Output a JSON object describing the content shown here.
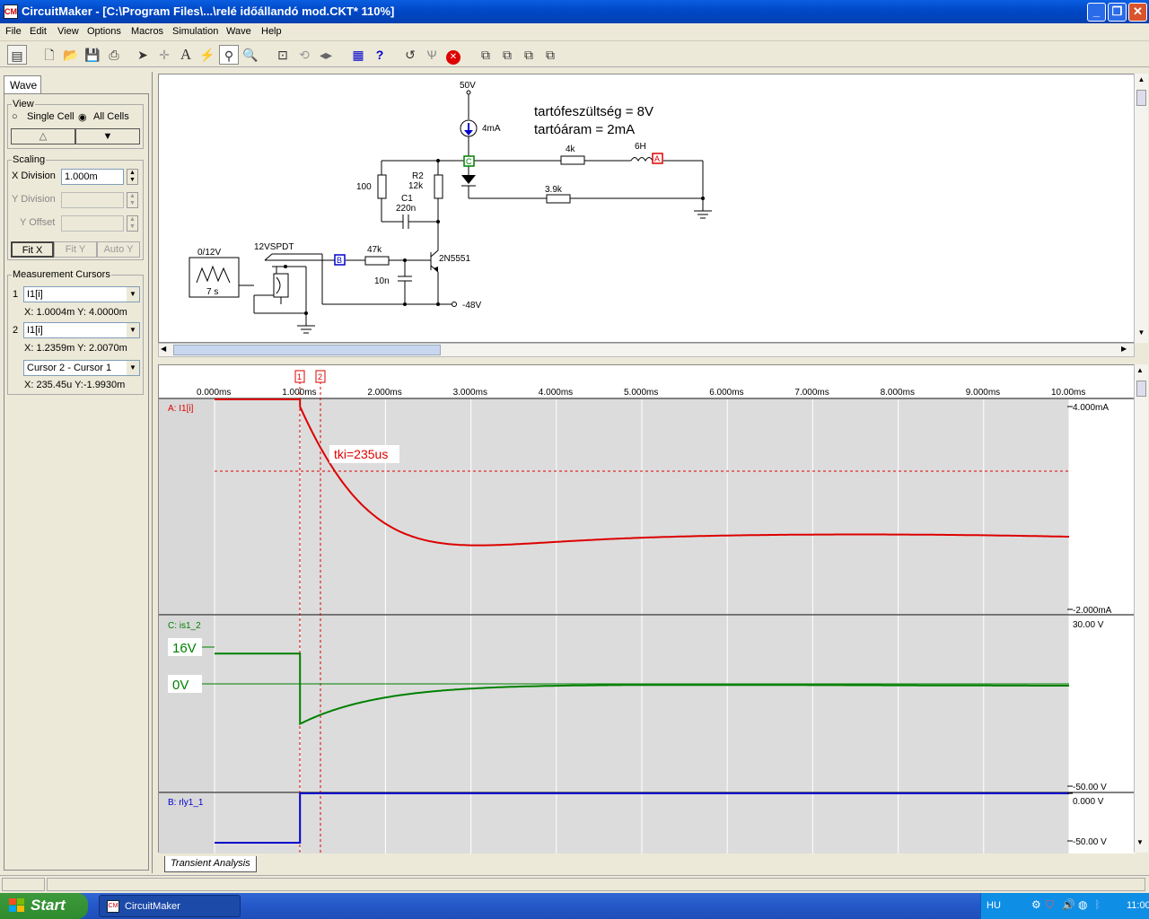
{
  "window": {
    "title": "CircuitMaker - [C:\\Program Files\\...\\relé időállandó mod.CKT* 110%]",
    "icon": "circuitmaker-icon"
  },
  "menu": [
    "File",
    "Edit",
    "View",
    "Options",
    "Macros",
    "Simulation",
    "Wave",
    "Help"
  ],
  "toolbar": {
    "icons": [
      "toggle-view-icon",
      "new-file-icon",
      "open-file-icon",
      "save-icon",
      "print-icon",
      "arrow-tool-icon",
      "wire-tool-icon",
      "text-tool-icon",
      "probe-tool-icon",
      "zoom-icon",
      "magnify-icon",
      "fit-icon",
      "rotate-icon",
      "mirror-icon",
      "digital-mode-icon",
      "help-icon",
      "undo-icon",
      "run-icon",
      "stop-icon",
      "wave-1-icon",
      "wave-2-icon",
      "wave-3-icon",
      "wave-4-icon"
    ]
  },
  "panel": {
    "tab": "Wave",
    "view_legend": "View",
    "single_cell": "Single Cell",
    "all_cells": "All Cells",
    "scaling_legend": "Scaling",
    "x_division_label": "X Division",
    "x_division_value": "1.000m",
    "y_division_label": "Y Division",
    "y_offset_label": "Y Offset",
    "fit_x": "Fit X",
    "fit_y": "Fit Y",
    "auto_y": "Auto Y",
    "cursors_legend": "Measurement Cursors",
    "cursor1_num": "1",
    "cursor1_sel": "I1[i]",
    "cursor1_readout": "X: 1.0004m  Y: 4.0000m",
    "cursor2_num": "2",
    "cursor2_sel": "I1[i]",
    "cursor2_readout": "X: 1.2359m  Y: 2.0070m",
    "diff_sel": "Cursor 2 - Cursor 1",
    "diff_readout": "X: 235.45u  Y:-1.9930m"
  },
  "schematic": {
    "note1": "tartófeszültség = 8V",
    "note2": "tartóáram = 2mA",
    "v50": "50V",
    "i4ma": "4mA",
    "r100": "100",
    "r2": "R2",
    "r12k": "12k",
    "c1": "C1",
    "c220n": "220n",
    "r4k": "4k",
    "l6h": "6H",
    "r39k": "3.9k",
    "src": "0/12V",
    "src_t": "7 s",
    "relay": "12VSPDT",
    "r47k": "47k",
    "c10n": "10n",
    "trans": "2N5551",
    "vneg": "-48V",
    "probe_c": "C",
    "probe_a": "A",
    "probe_b": "B"
  },
  "wave": {
    "tab": "Transient Analysis",
    "x_ticks": [
      "0.000ms",
      "1.000ms",
      "2.000ms",
      "3.000ms",
      "4.000ms",
      "5.000ms",
      "6.000ms",
      "7.000ms",
      "8.000ms",
      "9.000ms",
      "10.00ms"
    ],
    "cursor_marks": [
      "1",
      "2"
    ],
    "annotation": "tki=235us",
    "cells": [
      {
        "name": "A: I1[i]",
        "ymax": "4.000mA",
        "ymin": "-2.000mA",
        "color": "#dd0000"
      },
      {
        "name": "C: is1_2",
        "ymax": "30.00 V",
        "ymin": "-50.00 V",
        "color": "#008000",
        "tag1": "16V",
        "tag2": "0V"
      },
      {
        "name": "B: rly1_1",
        "ymax": "0.000 V",
        "ymin": "-50.00 V",
        "color": "#0000cc"
      }
    ]
  },
  "taskbar": {
    "start": "Start",
    "item": "CircuitMaker",
    "lang": "HU",
    "clock": "11:00"
  }
}
